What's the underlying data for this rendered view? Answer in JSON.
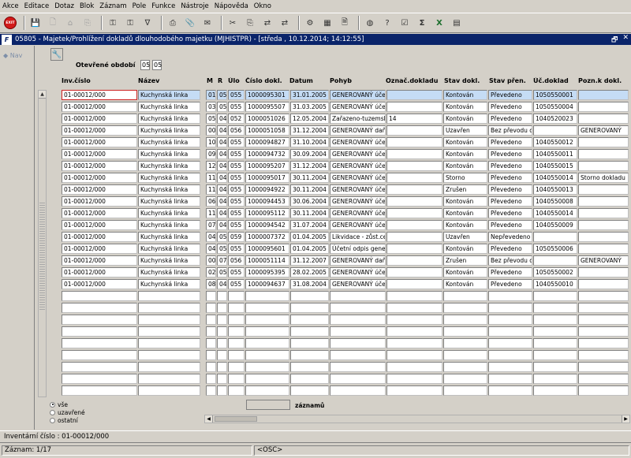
{
  "menu": [
    "Akce",
    "Editace",
    "Dotaz",
    "Blok",
    "Záznam",
    "Pole",
    "Funkce",
    "Nástroje",
    "Nápověda",
    "Okno"
  ],
  "toolbar": {
    "exit_label": "EXIT",
    "icons": [
      "save-icon",
      "print-preview-icon",
      "home-icon",
      "copy-icon",
      "key-icon",
      "key-icon",
      "filter-icon",
      "printer-icon",
      "attach-icon",
      "mail-icon",
      "scissors-icon",
      "copy-icon",
      "transfer-icon",
      "transfer-icon",
      "settings-icon",
      "table-icon",
      "document-icon",
      "globe-icon",
      "help-icon",
      "check-icon",
      "sum-icon",
      "excel-icon",
      "grid-icon"
    ]
  },
  "window": {
    "icon_letter": "F",
    "title": "05805 - Majetek/Prohlížení dokladů dlouhodobého majetku (MJHISTPR) - [středa , 10.12.2014; 14:12:55]",
    "btn_restore": "🗗",
    "btn_close": "✕"
  },
  "nav": {
    "label": "Nav"
  },
  "form": {
    "period_label": "Otevřené období",
    "period_from": "05",
    "period_to": "05"
  },
  "columns": [
    {
      "key": "inv",
      "label": "Inv.číslo"
    },
    {
      "key": "name",
      "label": "Název"
    },
    {
      "key": "m",
      "label": "M"
    },
    {
      "key": "r",
      "label": "R"
    },
    {
      "key": "ulo",
      "label": "Úlo"
    },
    {
      "key": "doc",
      "label": "Číslo dokl."
    },
    {
      "key": "date",
      "label": "Datum"
    },
    {
      "key": "pohyb",
      "label": "Pohyb"
    },
    {
      "key": "oznac",
      "label": "Označ.dokladu"
    },
    {
      "key": "stav",
      "label": "Stav dokl."
    },
    {
      "key": "stavp",
      "label": "Stav přen."
    },
    {
      "key": "ucd",
      "label": "Úč.doklad"
    },
    {
      "key": "pozn",
      "label": "Pozn.k dokl."
    }
  ],
  "rows": [
    {
      "inv": "01-00012/000",
      "name": "Kuchynská linka",
      "m": "01",
      "r": "05",
      "ulo": "055",
      "doc": "1000095301",
      "date": "31.01.2005",
      "pohyb": "GENEROVANÝ účetní",
      "oznac": "",
      "stav": "Kontován",
      "stavp": "Převedeno",
      "ucd": "1050550001",
      "pozn": ""
    },
    {
      "inv": "01-00012/000",
      "name": "Kuchynská linka",
      "m": "03",
      "r": "05",
      "ulo": "055",
      "doc": "1000095507",
      "date": "31.03.2005",
      "pohyb": "GENEROVANÝ účetní",
      "oznac": "",
      "stav": "Kontován",
      "stavp": "Převedeno",
      "ucd": "1050550004",
      "pozn": ""
    },
    {
      "inv": "01-00012/000",
      "name": "Kuchynská linka",
      "m": "05",
      "r": "04",
      "ulo": "052",
      "doc": "1000051026",
      "date": "12.05.2004",
      "pohyb": "Zařazeno-tuzemsko",
      "oznac": "14",
      "stav": "Kontován",
      "stavp": "Převedeno",
      "ucd": "1040520023",
      "pozn": ""
    },
    {
      "inv": "01-00012/000",
      "name": "Kuchynská linka",
      "m": "00",
      "r": "04",
      "ulo": "056",
      "doc": "1000051058",
      "date": "31.12.2004",
      "pohyb": "GENEROVANÝ daňový",
      "oznac": "",
      "stav": "Uzavřen",
      "stavp": "Bez převodu do",
      "ucd": "",
      "pozn": "GENEROVANÝ"
    },
    {
      "inv": "01-00012/000",
      "name": "Kuchynská linka",
      "m": "10",
      "r": "04",
      "ulo": "055",
      "doc": "1000094827",
      "date": "31.10.2004",
      "pohyb": "GENEROVANÝ účetní",
      "oznac": "",
      "stav": "Kontován",
      "stavp": "Převedeno",
      "ucd": "1040550012",
      "pozn": ""
    },
    {
      "inv": "01-00012/000",
      "name": "Kuchynská linka",
      "m": "09",
      "r": "04",
      "ulo": "055",
      "doc": "1000094732",
      "date": "30.09.2004",
      "pohyb": "GENEROVANÝ účetní",
      "oznac": "",
      "stav": "Kontován",
      "stavp": "Převedeno",
      "ucd": "1040550011",
      "pozn": ""
    },
    {
      "inv": "01-00012/000",
      "name": "Kuchynská linka",
      "m": "12",
      "r": "04",
      "ulo": "055",
      "doc": "1000095207",
      "date": "31.12.2004",
      "pohyb": "GENEROVANÝ účetní",
      "oznac": "",
      "stav": "Kontován",
      "stavp": "Převedeno",
      "ucd": "1040550015",
      "pozn": ""
    },
    {
      "inv": "01-00012/000",
      "name": "Kuchynská linka",
      "m": "11",
      "r": "04",
      "ulo": "055",
      "doc": "1000095017",
      "date": "30.11.2004",
      "pohyb": "GENEROVANÝ účetní",
      "oznac": "",
      "stav": "Storno",
      "stavp": "Převedeno",
      "ucd": "1040550014",
      "pozn": "Storno dokladu"
    },
    {
      "inv": "01-00012/000",
      "name": "Kuchynská linka",
      "m": "11",
      "r": "04",
      "ulo": "055",
      "doc": "1000094922",
      "date": "30.11.2004",
      "pohyb": "GENEROVANÝ účetní",
      "oznac": "",
      "stav": "Zrušen",
      "stavp": "Převedeno",
      "ucd": "1040550013",
      "pozn": ""
    },
    {
      "inv": "01-00012/000",
      "name": "Kuchynská linka",
      "m": "06",
      "r": "04",
      "ulo": "055",
      "doc": "1000094453",
      "date": "30.06.2004",
      "pohyb": "GENEROVANÝ účetní",
      "oznac": "",
      "stav": "Kontován",
      "stavp": "Převedeno",
      "ucd": "1040550008",
      "pozn": ""
    },
    {
      "inv": "01-00012/000",
      "name": "Kuchynská linka",
      "m": "11",
      "r": "04",
      "ulo": "055",
      "doc": "1000095112",
      "date": "30.11.2004",
      "pohyb": "GENEROVANÝ účetní",
      "oznac": "",
      "stav": "Kontován",
      "stavp": "Převedeno",
      "ucd": "1040550014",
      "pozn": ""
    },
    {
      "inv": "01-00012/000",
      "name": "Kuchynská linka",
      "m": "07",
      "r": "04",
      "ulo": "055",
      "doc": "1000094542",
      "date": "31.07.2004",
      "pohyb": "GENEROVANÝ účetní",
      "oznac": "",
      "stav": "Kontován",
      "stavp": "Převedeno",
      "ucd": "1040550009",
      "pozn": ""
    },
    {
      "inv": "01-00012/000",
      "name": "Kuchynská linka",
      "m": "04",
      "r": "05",
      "ulo": "059",
      "doc": "1000007372",
      "date": "01.04.2005",
      "pohyb": "Likvidace - zůst.cena",
      "oznac": "",
      "stav": "Uzavřen",
      "stavp": "Nepřevedeno",
      "ucd": "",
      "pozn": ""
    },
    {
      "inv": "01-00012/000",
      "name": "Kuchynská linka",
      "m": "04",
      "r": "05",
      "ulo": "055",
      "doc": "1000095601",
      "date": "01.04.2005",
      "pohyb": "Účetní odpis generovaný",
      "oznac": "",
      "stav": "Kontován",
      "stavp": "Převedeno",
      "ucd": "1050550006",
      "pozn": ""
    },
    {
      "inv": "01-00012/000",
      "name": "Kuchynská linka",
      "m": "00",
      "r": "07",
      "ulo": "056",
      "doc": "1000051114",
      "date": "31.12.2007",
      "pohyb": "GENEROVANÝ daňový",
      "oznac": "",
      "stav": "Zrušen",
      "stavp": "Bez převodu do",
      "ucd": "",
      "pozn": "GENEROVANÝ"
    },
    {
      "inv": "01-00012/000",
      "name": "Kuchynská linka",
      "m": "02",
      "r": "05",
      "ulo": "055",
      "doc": "1000095395",
      "date": "28.02.2005",
      "pohyb": "GENEROVANÝ účetní",
      "oznac": "",
      "stav": "Kontován",
      "stavp": "Převedeno",
      "ucd": "1050550002",
      "pozn": ""
    },
    {
      "inv": "01-00012/000",
      "name": "Kuchynská linka",
      "m": "08",
      "r": "04",
      "ulo": "055",
      "doc": "1000094637",
      "date": "31.08.2004",
      "pohyb": "GENEROVANÝ účetní",
      "oznac": "",
      "stav": "Kontován",
      "stavp": "Převedeno",
      "ucd": "1040550010",
      "pozn": ""
    }
  ],
  "empty_rows": 9,
  "selected_row": 0,
  "radio": [
    {
      "label": "vše",
      "checked": true
    },
    {
      "label": "uzavřené",
      "checked": false
    },
    {
      "label": "ostatní",
      "checked": false
    }
  ],
  "records_label": "záznamů",
  "records_count": "",
  "status": {
    "line1": "Inventární číslo : 01-00012/000",
    "record": "Záznam: 1/17",
    "osc": "<OSC>"
  }
}
